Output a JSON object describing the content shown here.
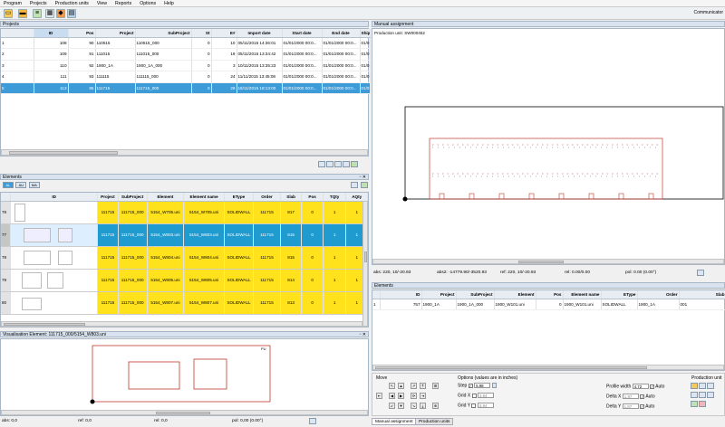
{
  "menu": [
    "Program",
    "Projects",
    "Production units",
    "View",
    "Reports",
    "Options",
    "Help"
  ],
  "toolbar": {
    "communicator": "Communicator"
  },
  "projects": {
    "title": "Projects",
    "columns": [
      "ID",
      "Pos",
      "Project",
      "SubProject",
      "St",
      "E#",
      "Import date",
      "Start date",
      "End date",
      "Ship"
    ],
    "rows": [
      [
        "1",
        "108",
        "90",
        "110515",
        "110515_000",
        "0",
        "10",
        "05/11/2015 14:36:01",
        "01/01/2000 00:0...",
        "01/01/2000 00:0...",
        "01/0"
      ],
      [
        "2",
        "109",
        "91",
        "111015",
        "111015_000",
        "0",
        "19",
        "05/11/2015 13:34:42",
        "01/01/2000 00:0...",
        "01/01/2000 00:0...",
        "01/0"
      ],
      [
        "3",
        "110",
        "92",
        "1900_1A",
        "1900_1A_000",
        "0",
        "3",
        "10/11/2015 13:35:23",
        "01/01/2000 00:0...",
        "01/01/2000 00:0...",
        "01/0"
      ],
      [
        "4",
        "111",
        "93",
        "111115",
        "111115_000",
        "0",
        "24",
        "11/11/2015 13:45:08",
        "01/01/2000 00:0...",
        "01/01/2000 00:0...",
        "01/0"
      ],
      [
        "5",
        "113",
        "95",
        "111715",
        "111715_000",
        "0",
        "29",
        "18/11/2015 18:13:00",
        "01/01/2000 00:0...",
        "01/01/2000 00:0...",
        "01/0"
      ]
    ]
  },
  "elements": {
    "title": "Elements",
    "tabs": [
      "AL",
      "AU",
      "MA"
    ],
    "columns": [
      "",
      "ID",
      "Project",
      "SubProject",
      "Element",
      "Element name",
      "EType",
      "Order",
      "Slab",
      "Pos",
      "TQty",
      "AQty"
    ],
    "rows": [
      [
        "78",
        "111715",
        "111715_000",
        "5154_W705.uni",
        "5154_W705.uni",
        "SOLIDWALL",
        "111715",
        "817",
        "0",
        "1",
        "1"
      ],
      [
        "77",
        "111715",
        "111715_000",
        "5154_W803.uni",
        "5154_W803.uni",
        "SOLIDWALL",
        "111715",
        "816",
        "0",
        "1",
        "1"
      ],
      [
        "78",
        "111715",
        "111715_000",
        "5154_W804.uni",
        "5154_W804.uni",
        "SOLIDWALL",
        "111715",
        "815",
        "0",
        "1",
        "1"
      ],
      [
        "79",
        "111715",
        "111715_000",
        "5154_W805.uni",
        "5154_W805.uni",
        "SOLIDWALL",
        "111715",
        "814",
        "0",
        "1",
        "1"
      ],
      [
        "80",
        "111715",
        "111715_000",
        "5154_W807.uni",
        "5154_W807.uni",
        "SOLIDWALL",
        "111715",
        "813",
        "0",
        "1",
        "1"
      ]
    ]
  },
  "visualisation": {
    "title": "Visualisation Element: 111715_000/5154_W803.uni",
    "corner": "PU"
  },
  "status_left": {
    "abs": "abs: 0,0",
    "ref": "ref: 0,0",
    "rel": "rel: 0,0",
    "pol": "pol: 0,00 (0.00°)"
  },
  "manual": {
    "title": "Manual assignment",
    "unit": "Production unit: SW000452",
    "status": {
      "abs": "abs: 220, 10/-20.93",
      "abs2": "abs2: -14779.90/-3520.93",
      "ref": "ref: 220, 10/-20.93",
      "rel": "rel: 0.00/0.00",
      "pol": "pol: 0.00 (0.00°)"
    }
  },
  "el2": {
    "title": "Elements",
    "columns": [
      "",
      "ID",
      "Project",
      "SubProject",
      "Element",
      "Pos",
      "Element name",
      "EType",
      "Order",
      "Slab"
    ],
    "row": [
      "1",
      "757",
      "1900_1A",
      "1900_1A_000",
      "1900_W101.uni",
      "0",
      "1900_W101.uni",
      "SOLIDWALL",
      "1900_1A",
      "001"
    ]
  },
  "move": {
    "title": "Move",
    "options_title": "Options (values are in inches)",
    "step_label": "Step",
    "step_value": "5.98",
    "gridx_label": "Grid X",
    "gridx_value": "3.94",
    "gridy_label": "Grid Y",
    "gridy_value": "3.94",
    "profile_label": "Profile width",
    "profile_value": "4.72",
    "deltax_label": "Delta X",
    "deltax_value": "1.97",
    "deltay_label": "Delta Y",
    "deltay_value": "1.97",
    "auto_label": "Auto",
    "pu_label": "Production unit"
  },
  "bottom_tabs": [
    "Manual assignment",
    "Production units"
  ]
}
